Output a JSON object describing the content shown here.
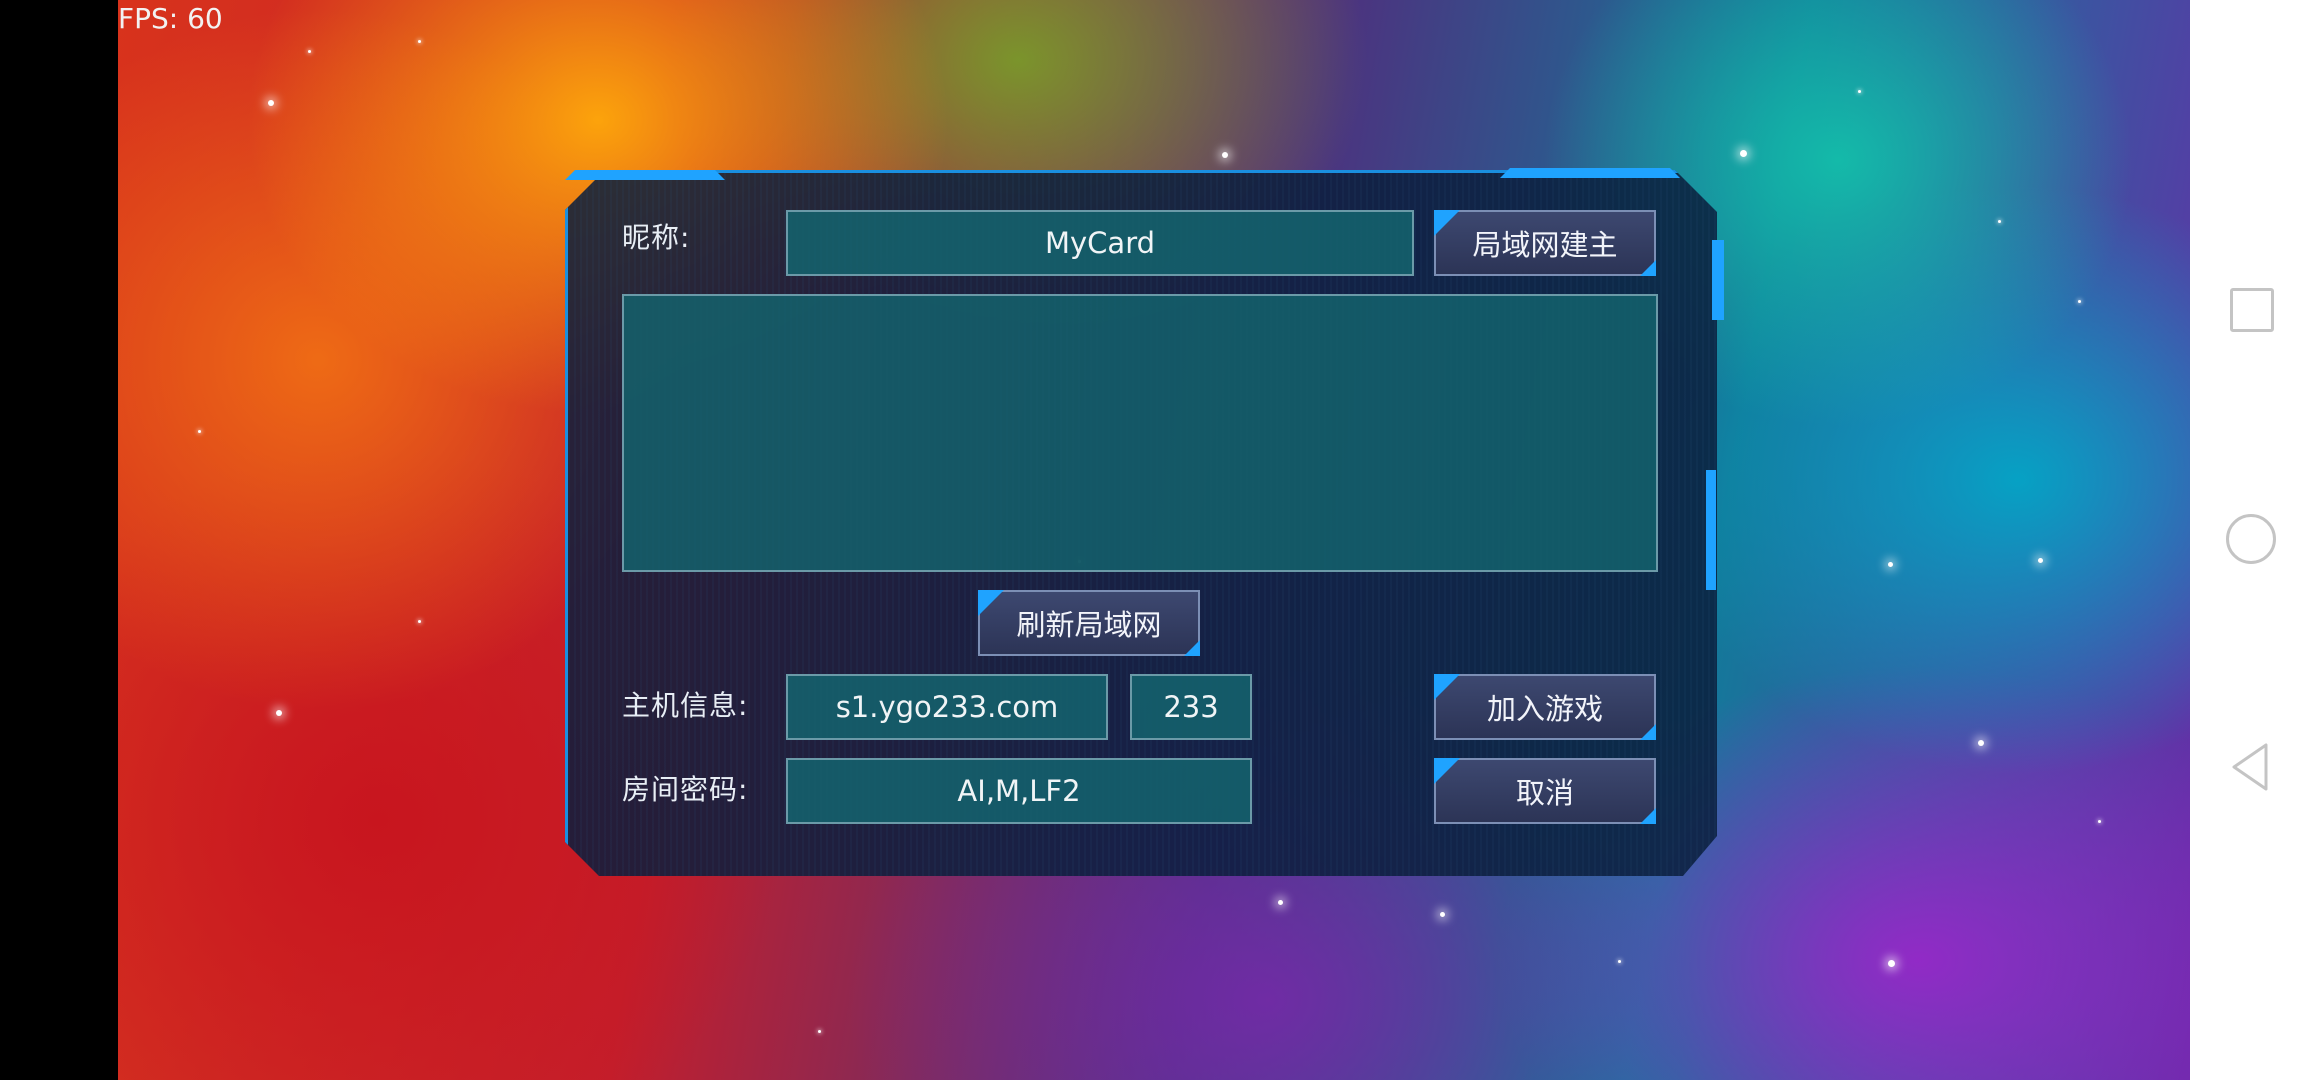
{
  "status": {
    "fps": "FPS: 60"
  },
  "dialog": {
    "nickname_label": "昵称:",
    "nickname_value": "MyCard",
    "lan_host_button": "局域网建主",
    "refresh_lan_button": "刷新局域网",
    "host_info_label": "主机信息:",
    "host_address": "s1.ygo233.com",
    "host_port": "233",
    "join_game_button": "加入游戏",
    "room_password_label": "房间密码:",
    "room_password": "AI,M,LF2",
    "cancel_button": "取消"
  },
  "navbar": {
    "icons": [
      "recent-apps-icon",
      "home-icon",
      "back-icon"
    ]
  },
  "colors": {
    "dialog_border": "#1a8fe0",
    "field_bg": "#14646e",
    "button_bg": "#3d4870"
  }
}
